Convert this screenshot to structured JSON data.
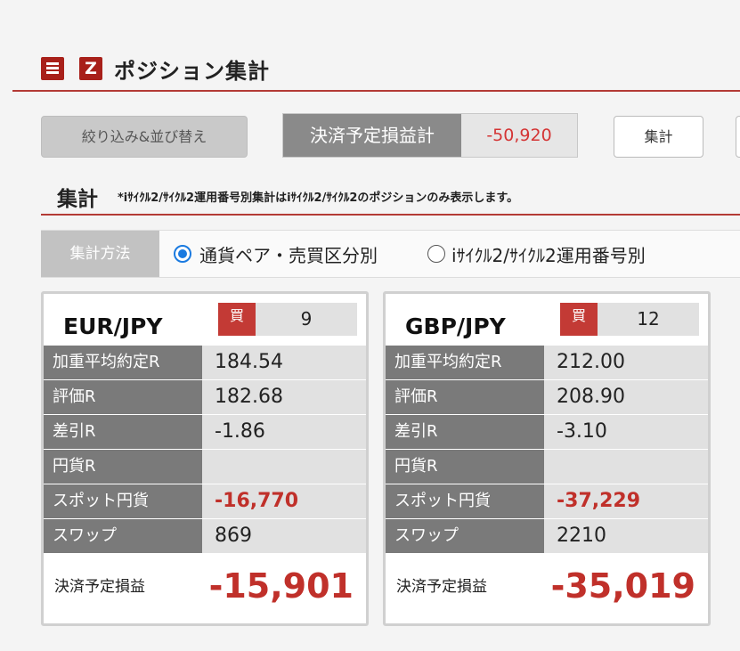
{
  "header": {
    "menu_icon": "menu-icon",
    "logo_letter": "Z",
    "title": "ポジション集計"
  },
  "toolbar": {
    "filter_label": "絞り込み&並び替え",
    "pl_label": "決済予定損益計",
    "pl_value": "-50,920",
    "total_label": "集計"
  },
  "section": {
    "title": "集計",
    "note": "*iｻｲｸﾙ2/ｻｲｸﾙ2運用番号別集計はiｻｲｸﾙ2/ｻｲｸﾙ2のポジションのみ表示します。"
  },
  "method": {
    "label": "集計方法",
    "options": [
      {
        "label": "通貨ペア・売買区分別",
        "selected": true
      },
      {
        "label": "iｻｲｸﾙ2/ｻｲｸﾙ2運用番号別",
        "selected": false
      }
    ]
  },
  "cards": [
    {
      "pair": "EUR/JPY",
      "side": "買",
      "quantity": "9",
      "rows": [
        {
          "label": "加重平均約定R",
          "value": "184.54"
        },
        {
          "label": "評価R",
          "value": "182.68"
        },
        {
          "label": "差引R",
          "value": "-1.86"
        },
        {
          "label": "円貨R",
          "value": ""
        },
        {
          "label": "スポット円貨",
          "value": "-16,770"
        },
        {
          "label": "スワップ",
          "value": "869"
        }
      ],
      "pl_label": "決済予定損益",
      "pl_value": "-15,901"
    },
    {
      "pair": "GBP/JPY",
      "side": "買",
      "quantity": "12",
      "rows": [
        {
          "label": "加重平均約定R",
          "value": "212.00"
        },
        {
          "label": "評価R",
          "value": "208.90"
        },
        {
          "label": "差引R",
          "value": "-3.10"
        },
        {
          "label": "円貨R",
          "value": ""
        },
        {
          "label": "スポット円貨",
          "value": "-37,229"
        },
        {
          "label": "スワップ",
          "value": "2210"
        }
      ],
      "pl_label": "決済予定損益",
      "pl_value": "-35,019"
    }
  ],
  "colors": {
    "brand_red": "#a8201a",
    "negative_red": "#c0302a",
    "radio_blue": "#1a7ae0"
  }
}
